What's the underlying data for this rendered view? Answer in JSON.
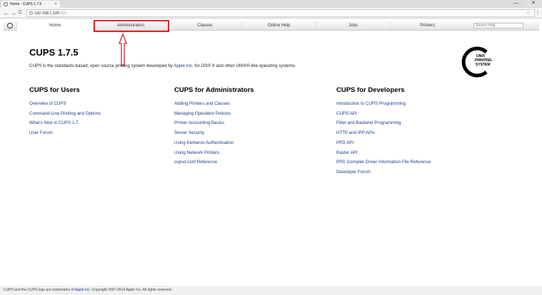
{
  "browser": {
    "tab_title": "Home - CUPS 1.7.5",
    "tab_close": "×",
    "win_minimize": "—",
    "win_close": "✕",
    "url_host": "192.168.1.105",
    "url_port": ":631",
    "back": "←",
    "forward": "→",
    "reload": "C"
  },
  "cups_nav": {
    "items": [
      "Home",
      "Administration",
      "Classes",
      "Online Help",
      "Jobs",
      "Printers"
    ],
    "search_placeholder": "Search Help",
    "highlight_color": "#e0262a"
  },
  "main": {
    "title": "CUPS 1.7.5",
    "intro_pre": "CUPS is the standards-based, open source printing system developed by ",
    "intro_link": "Apple Inc.",
    "intro_post": " for OS® X and other UNIX®-like operating systems.",
    "logo_text": [
      "UNIX",
      "PRINTING",
      "SYSTEM"
    ]
  },
  "columns": [
    {
      "title": "CUPS for Users",
      "links": [
        "Overview of CUPS",
        "Command-Line Printing and Options",
        "What's New in CUPS 1.7",
        "User Forum"
      ]
    },
    {
      "title": "CUPS for Administrators",
      "links": [
        "Adding Printers and Classes",
        "Managing Operation Policies",
        "Printer Accounting Basics",
        "Server Security",
        "Using Kerberos Authentication",
        "Using Network Printers",
        "cupsd.conf Reference"
      ]
    },
    {
      "title": "CUPS for Developers",
      "links": [
        "Introduction to CUPS Programming",
        "CUPS API",
        "Filter and Backend Programming",
        "HTTP and IPP APIs",
        "PPD API",
        "Raster API",
        "PPD Compiler Driver Information File Reference",
        "Developer Forum"
      ]
    }
  ],
  "footer": {
    "pre": "CUPS and the CUPS logo are trademarks of ",
    "link": "Apple Inc.",
    "post": " Copyright 2007-2014 Apple Inc. All rights reserved."
  }
}
